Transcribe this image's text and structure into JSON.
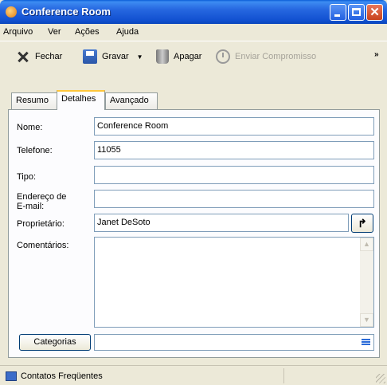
{
  "window": {
    "title": "Conference Room"
  },
  "menu": [
    {
      "label": "Arquivo"
    },
    {
      "label": "Ver"
    },
    {
      "label": "Ações"
    },
    {
      "label": "Ajuda"
    }
  ],
  "toolbar": {
    "close_label": "Fechar",
    "save_label": "Gravar",
    "delete_label": "Apagar",
    "send_label": "Enviar Compromisso",
    "more": "»"
  },
  "tabs": [
    {
      "label": "Resumo",
      "active": false
    },
    {
      "label": "Detalhes",
      "active": true
    },
    {
      "label": "Avançado",
      "active": false
    }
  ],
  "form": {
    "name_label": "Nome:",
    "name_value": "Conference Room",
    "phone_label": "Telefone:",
    "phone_value": "11055",
    "type_label": "Tipo:",
    "type_value": "",
    "email_label_1": "Endereço de",
    "email_label_2": "E-mail:",
    "email_value": "",
    "owner_label": "Proprietário:",
    "owner_value": "Janet DeSoto",
    "comments_label": "Comentários:",
    "categories_button": "Categorias",
    "categories_value": ""
  },
  "statusbar": {
    "text": "Contatos Freqüentes"
  }
}
